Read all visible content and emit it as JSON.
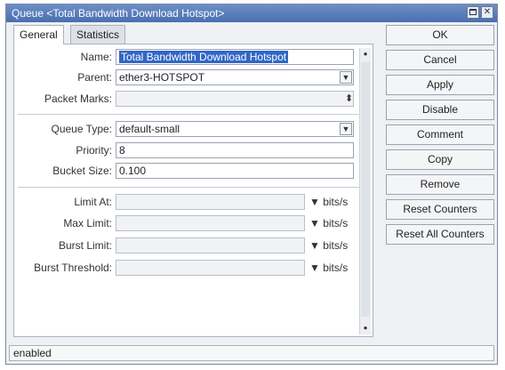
{
  "window": {
    "title": "Queue <Total Bandwidth Download Hotspot>",
    "tabs": [
      "General",
      "Statistics"
    ]
  },
  "form": {
    "name": {
      "label": "Name:",
      "value": "Total Bandwidth Download Hotspot"
    },
    "parent": {
      "label": "Parent:",
      "value": "ether3-HOTSPOT"
    },
    "packet_marks": {
      "label": "Packet Marks:",
      "value": ""
    },
    "queue_type": {
      "label": "Queue Type:",
      "value": "default-small"
    },
    "priority": {
      "label": "Priority:",
      "value": "8"
    },
    "bucket_size": {
      "label": "Bucket Size:",
      "value": "0.100"
    },
    "limit_at": {
      "label": "Limit At:",
      "value": "",
      "unit": "bits/s"
    },
    "max_limit": {
      "label": "Max Limit:",
      "value": "",
      "unit": "bits/s"
    },
    "burst_limit": {
      "label": "Burst Limit:",
      "value": "",
      "unit": "bits/s"
    },
    "burst_threshold": {
      "label": "Burst Threshold:",
      "value": "",
      "unit": "bits/s"
    }
  },
  "buttons": {
    "ok": "OK",
    "cancel": "Cancel",
    "apply": "Apply",
    "disable": "Disable",
    "comment": "Comment",
    "copy": "Copy",
    "remove": "Remove",
    "reset_counters": "Reset Counters",
    "reset_all_counters": "Reset All Counters"
  },
  "status": "enabled",
  "icons": {
    "dropdown": "triangle-down-icon",
    "updown": "up-down-arrows-icon",
    "close": "close-icon",
    "maximize": "maximize-icon"
  }
}
